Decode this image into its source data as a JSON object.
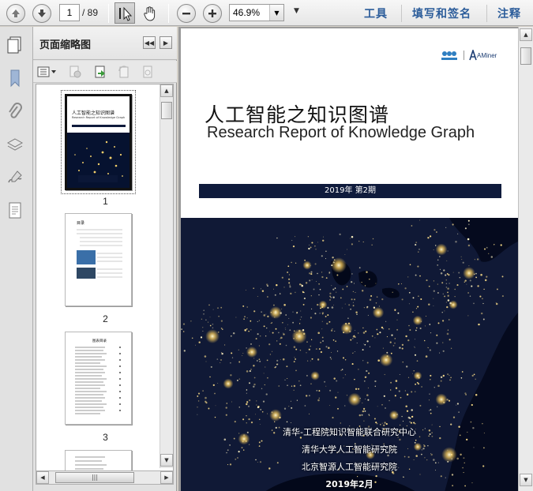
{
  "toolbar": {
    "current_page": "1",
    "total_pages": "/ 89",
    "zoom": "46.9%",
    "links": [
      "工具",
      "填写和签名",
      "注释"
    ]
  },
  "panel": {
    "title": "页面缩略图",
    "thumbnails": [
      {
        "number": "1"
      },
      {
        "number": "2"
      },
      {
        "number": "3"
      }
    ],
    "thumb1": {
      "title_cn": "人工智能之知识图谱",
      "title_en": "Research Report of Knowledge Graph"
    },
    "thumb2": {
      "title": "目录"
    },
    "thumb3": {
      "title": "图表目录"
    }
  },
  "document": {
    "title_cn": "人工智能之知识图谱",
    "title_en": "Research Report of Knowledge Graph",
    "issue": "2019年 第2期",
    "logo_text": "AMiner",
    "orgs": [
      "清华-工程院知识智能联合研究中心",
      "清华大学人工智能研究院",
      "北京智源人工智能研究院"
    ],
    "date": "2019年2月"
  },
  "colors": {
    "link": "#2b5c9a",
    "band": "#0f1b3c",
    "night": "#050a1e",
    "lights": "#ffe08a"
  }
}
